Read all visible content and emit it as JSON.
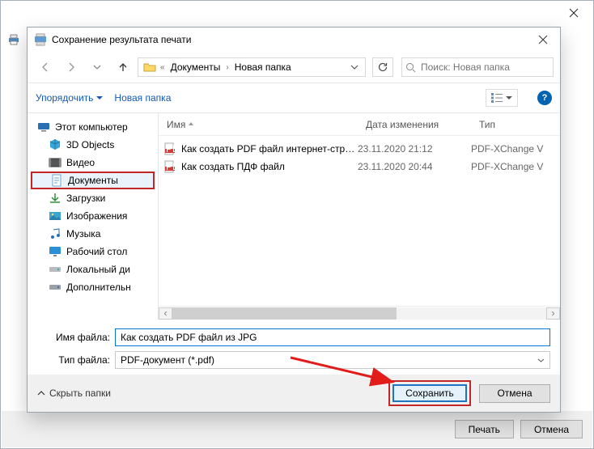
{
  "parent": {
    "print_label": "Печать",
    "cancel_label": "Отмена"
  },
  "dialog": {
    "title": "Сохранение результата печати",
    "breadcrumb": {
      "prefix_glyph": "«",
      "parts": [
        "Документы",
        "Новая папка"
      ]
    },
    "search": {
      "placeholder": "Поиск: Новая папка"
    },
    "toolbar": {
      "organize": "Упорядочить",
      "newfolder": "Новая папка"
    },
    "tree": {
      "items": [
        {
          "label": "Этот компьютер",
          "icon": "pc"
        },
        {
          "label": "3D Objects",
          "icon": "3d"
        },
        {
          "label": "Видео",
          "icon": "video"
        },
        {
          "label": "Документы",
          "icon": "doc",
          "selected": true
        },
        {
          "label": "Загрузки",
          "icon": "dl"
        },
        {
          "label": "Изображения",
          "icon": "img"
        },
        {
          "label": "Музыка",
          "icon": "music"
        },
        {
          "label": "Рабочий стол",
          "icon": "desk"
        },
        {
          "label": "Локальный ди",
          "icon": "disk"
        },
        {
          "label": "Дополнительн",
          "icon": "disk2"
        }
      ]
    },
    "columns": {
      "name": "Имя",
      "date": "Дата изменения",
      "type": "Тип"
    },
    "files": [
      {
        "name": "Как создать PDF файл интернет-страни...",
        "date": "23.11.2020 21:12",
        "type": "PDF-XChange V"
      },
      {
        "name": "Как создать ПДФ файл",
        "date": "23.11.2020 20:44",
        "type": "PDF-XChange V"
      }
    ],
    "form": {
      "name_label": "Имя файла:",
      "name_value": "Как создать PDF файл из JPG",
      "type_label": "Тип файла:",
      "type_value": "PDF-документ (*.pdf)"
    },
    "footer": {
      "hide_folders": "Скрыть папки",
      "save": "Сохранить",
      "cancel": "Отмена"
    }
  }
}
